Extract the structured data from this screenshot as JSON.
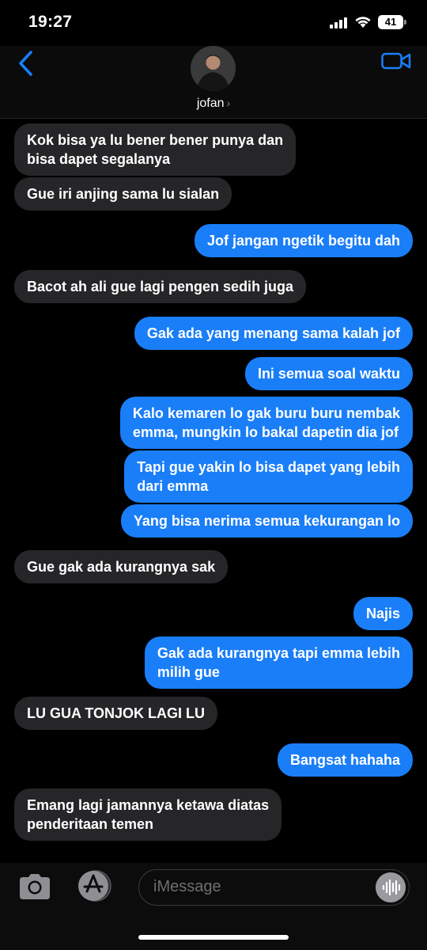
{
  "status_bar": {
    "time": "19:27",
    "battery": "41"
  },
  "header": {
    "contact_name": "jofan",
    "chevron": "›"
  },
  "messages": [
    {
      "dir": "in",
      "text": "Kok bisa ya lu bener bener punya dan\nbisa dapet segalanya"
    },
    {
      "dir": "in",
      "text": "Gue iri anjing sama lu sialan"
    },
    {
      "dir": "out",
      "text": "Jof jangan ngetik begitu dah"
    },
    {
      "dir": "in",
      "text": "Bacot ah ali gue lagi pengen sedih juga"
    },
    {
      "dir": "out",
      "text": "Gak ada yang menang sama kalah jof"
    },
    {
      "dir": "out",
      "text": "Ini semua soal waktu"
    },
    {
      "dir": "out",
      "text": "Kalo kemaren lo gak buru buru nembak\nemma, mungkin lo bakal dapetin dia jof"
    },
    {
      "dir": "out",
      "text": "Tapi gue yakin lo bisa dapet yang lebih\ndari emma"
    },
    {
      "dir": "out",
      "text": "Yang bisa nerima semua kekurangan lo"
    },
    {
      "dir": "in",
      "text": "Gue gak ada kurangnya sak"
    },
    {
      "dir": "out",
      "text": "Najis"
    },
    {
      "dir": "out",
      "text": "Gak ada kurangnya tapi emma lebih\nmilih gue"
    },
    {
      "dir": "in",
      "text": "LU GUA TONJOK LAGI LU"
    },
    {
      "dir": "out",
      "text": "Bangsat hahaha"
    },
    {
      "dir": "in",
      "text": "Emang lagi jamannya ketawa diatas\npenderitaan temen"
    }
  ],
  "input": {
    "placeholder": "iMessage"
  },
  "colors": {
    "outgoing": "#1a7ef8",
    "incoming": "#262629",
    "accent": "#1a7ef8"
  },
  "icons": [
    "back-chevron-icon",
    "facetime-video-icon",
    "camera-icon",
    "app-store-icon",
    "audio-waveform-icon"
  ]
}
